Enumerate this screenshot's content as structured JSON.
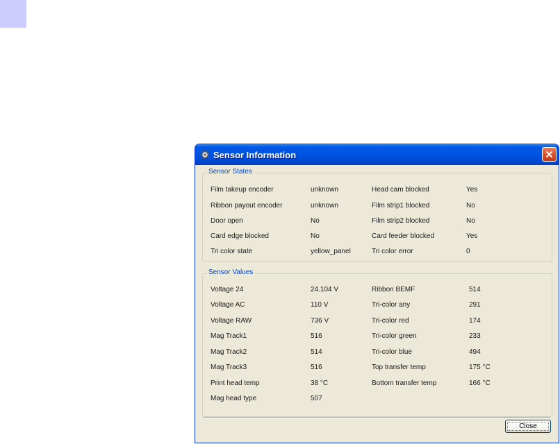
{
  "window": {
    "title": "Sensor Information",
    "icon": "gear-icon",
    "close_button_label": "Close"
  },
  "sensor_states": {
    "legend": "Sensor States",
    "left_column": [
      {
        "label": "Film takeup encoder",
        "value": "unknown"
      },
      {
        "label": "Ribbon payout encoder",
        "value": "unknown"
      },
      {
        "label": "Door open",
        "value": "No"
      },
      {
        "label": "Card edge blocked",
        "value": "No"
      },
      {
        "label": "Tri color state",
        "value": "yellow_panel"
      }
    ],
    "right_column": [
      {
        "label": "Head cam blocked",
        "value": "Yes"
      },
      {
        "label": "Film strip1 blocked",
        "value": "No"
      },
      {
        "label": "Film strip2 blocked",
        "value": "No"
      },
      {
        "label": "Card feeder blocked",
        "value": "Yes"
      },
      {
        "label": "Tri color error",
        "value": "0"
      }
    ]
  },
  "sensor_values": {
    "legend": "Sensor Values",
    "left_column": [
      {
        "label": "Voltage 24",
        "value": "24.104 V"
      },
      {
        "label": "Voltage AC",
        "value": "110 V"
      },
      {
        "label": "Voltage RAW",
        "value": "736 V"
      },
      {
        "label": "Mag Track1",
        "value": "516"
      },
      {
        "label": "Mag Track2",
        "value": "514"
      },
      {
        "label": "Mag Track3",
        "value": "516"
      },
      {
        "label": "Print head temp",
        "value": "38 °C"
      },
      {
        "label": "Mag head type",
        "value": "507"
      }
    ],
    "right_column": [
      {
        "label": "Ribbon BEMF",
        "value": "514"
      },
      {
        "label": "Tri-color any",
        "value": "291"
      },
      {
        "label": "Tri-color red",
        "value": "174"
      },
      {
        "label": "Tri-color green",
        "value": "233"
      },
      {
        "label": "Tri-color blue",
        "value": "494"
      },
      {
        "label": "Top transfer temp",
        "value": "175 °C"
      },
      {
        "label": "Bottom transfer temp",
        "value": "166 °C"
      }
    ]
  },
  "colors": {
    "title_bar": "#0054e3",
    "dialog_background": "#ece9d8",
    "group_label": "#0046d5",
    "close_x_button": "#d84a25",
    "corner_square": "#ccccff"
  }
}
